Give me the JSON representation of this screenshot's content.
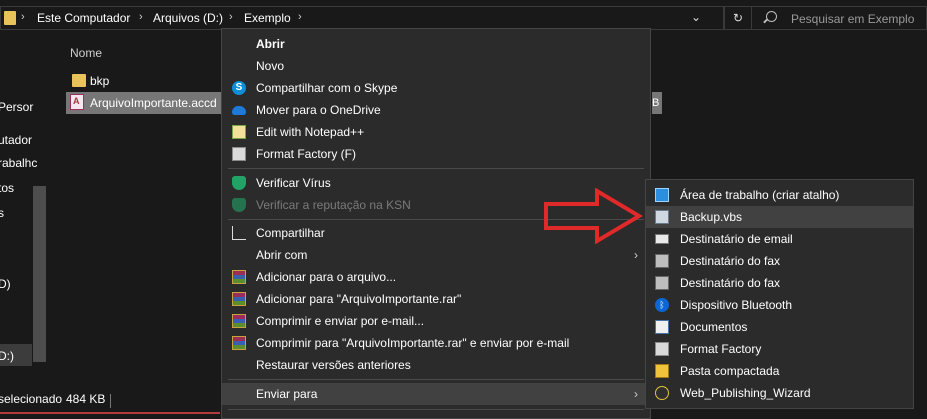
{
  "address": {
    "crumbs": [
      "Este Computador",
      "Arquivos (D:)",
      "Exemplo"
    ],
    "separator": "›",
    "dropdown": "⌄",
    "refresh": "↻",
    "search_placeholder": "Pesquisar em Exemplo"
  },
  "nav": {
    "items": [
      "Persor",
      "utador",
      "rabalhc",
      "tos",
      "s",
      "",
      "D)",
      "D:)"
    ]
  },
  "list": {
    "header_name": "Nome",
    "files": [
      {
        "name": "bkp",
        "type": "folder"
      },
      {
        "name": "ArquivoImportante.accd",
        "type": "access"
      }
    ],
    "fragment": "B"
  },
  "status": {
    "selected": "selecionado",
    "size": "484 KB"
  },
  "menu": {
    "items": [
      {
        "label": "Abrir",
        "icon": "none",
        "bold": true
      },
      {
        "label": "Novo",
        "icon": "none"
      },
      {
        "label": "Compartilhar com o Skype",
        "icon": "skype-icon"
      },
      {
        "label": "Mover para o OneDrive",
        "icon": "onedrive-icon"
      },
      {
        "label": "Edit with Notepad++",
        "icon": "notepad-icon"
      },
      {
        "label": "Format Factory (F)",
        "icon": "format-factory-icon"
      },
      {
        "label": "Verificar Vírus",
        "icon": "kaspersky-shield-icon"
      },
      {
        "label": "Verificar a reputação na KSN",
        "icon": "kaspersky-shield-icon",
        "disabled": true
      },
      {
        "label": "Compartilhar",
        "icon": "share-icon"
      },
      {
        "label": "Abrir com",
        "icon": "none",
        "submenu": true
      },
      {
        "label": "Adicionar para o arquivo...",
        "icon": "winrar-icon"
      },
      {
        "label": "Adicionar para \"ArquivoImportante.rar\"",
        "icon": "winrar-icon"
      },
      {
        "label": "Comprimir e enviar por e-mail...",
        "icon": "winrar-icon"
      },
      {
        "label": "Comprimir para \"ArquivoImportante.rar\" e enviar por e-mail",
        "icon": "winrar-icon"
      },
      {
        "label": "Restaurar versões anteriores",
        "icon": "none"
      },
      {
        "label": "Enviar para",
        "icon": "none",
        "submenu": true,
        "highlighted": true
      }
    ],
    "submenu_arrow": "›"
  },
  "send_to": {
    "items": [
      {
        "label": "Área de trabalho (criar atalho)",
        "icon": "desktop-icon"
      },
      {
        "label": "Backup.vbs",
        "icon": "vbs-script-icon",
        "highlighted": true
      },
      {
        "label": "Destinatário de email",
        "icon": "mail-icon"
      },
      {
        "label": "Destinatário do fax",
        "icon": "fax-icon"
      },
      {
        "label": "Destinatário do fax",
        "icon": "fax-icon"
      },
      {
        "label": "Dispositivo Bluetooth",
        "icon": "bluetooth-icon"
      },
      {
        "label": "Documentos",
        "icon": "documents-icon"
      },
      {
        "label": "Format Factory",
        "icon": "format-factory-icon"
      },
      {
        "label": "Pasta compactada",
        "icon": "zip-folder-icon"
      },
      {
        "label": "Web_Publishing_Wizard",
        "icon": "wizard-icon"
      }
    ]
  },
  "colors": {
    "background": "#191919",
    "menu_bg": "#2b2b2b",
    "highlight": "#414141",
    "annotation_arrow": "#e02a2a"
  }
}
